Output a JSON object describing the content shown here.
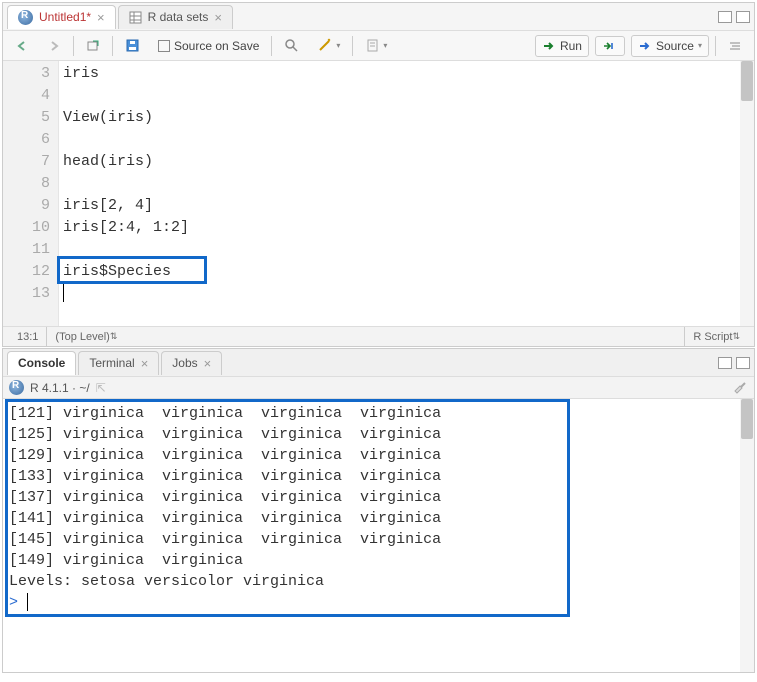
{
  "tabs": {
    "editor": [
      {
        "label": "Untitled1*",
        "active": true
      },
      {
        "label": "R data sets",
        "active": false
      }
    ],
    "console": [
      {
        "label": "Console",
        "active": true
      },
      {
        "label": "Terminal",
        "active": false
      },
      {
        "label": "Jobs",
        "active": false
      }
    ]
  },
  "toolbar": {
    "source_on_save": "Source on Save",
    "run": "Run",
    "source": "Source"
  },
  "editor": {
    "lines": [
      {
        "n": 3,
        "text": "iris"
      },
      {
        "n": 4,
        "text": ""
      },
      {
        "n": 5,
        "text": "View(iris)"
      },
      {
        "n": 6,
        "text": ""
      },
      {
        "n": 7,
        "text": "head(iris)"
      },
      {
        "n": 8,
        "text": ""
      },
      {
        "n": 9,
        "text": "iris[2, 4]"
      },
      {
        "n": 10,
        "text": "iris[2:4, 1:2]"
      },
      {
        "n": 11,
        "text": ""
      },
      {
        "n": 12,
        "text": "iris$Species"
      },
      {
        "n": 13,
        "text": ""
      }
    ]
  },
  "statusbar": {
    "pos": "13:1",
    "scope": "(Top Level) ",
    "lang": "R Script "
  },
  "console_header": {
    "version": "R 4.1.1 · ~/ "
  },
  "console_output": [
    "[121] virginica  virginica  virginica  virginica ",
    "[125] virginica  virginica  virginica  virginica ",
    "[129] virginica  virginica  virginica  virginica ",
    "[133] virginica  virginica  virginica  virginica ",
    "[137] virginica  virginica  virginica  virginica ",
    "[141] virginica  virginica  virginica  virginica ",
    "[145] virginica  virginica  virginica  virginica ",
    "[149] virginica  virginica ",
    "Levels: setosa versicolor virginica"
  ]
}
